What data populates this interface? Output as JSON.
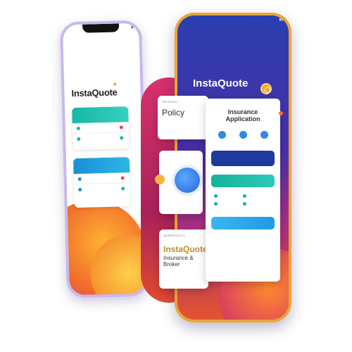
{
  "left_phone": {
    "status_time": "",
    "logo": "InstaQuote",
    "card_top": {
      "header": "",
      "rows": [
        "",
        ""
      ]
    },
    "card_bottom": {
      "header": "",
      "rows": [
        "",
        ""
      ]
    }
  },
  "right_phone": {
    "small_label": "",
    "title": "InstaQuote",
    "subtitle": ""
  },
  "policy_card": {
    "tag": "PROPOSAL",
    "title": "Policy",
    "desc": ""
  },
  "circle_card": {
    "center_label": "",
    "caption": ""
  },
  "insta_card": {
    "tag": "AGROPOLICY",
    "logo": "InstaQuote",
    "subtitle": "Insurance & Broker",
    "desc": ""
  },
  "application_card": {
    "tag": "",
    "title": "Insurance Application",
    "icons": [
      {
        "label": ""
      },
      {
        "label": ""
      },
      {
        "label": ""
      }
    ],
    "navy_button": "",
    "section_label": "",
    "teal_button": "",
    "grid": [
      "",
      "",
      "",
      ""
    ],
    "sky_button": ""
  },
  "colors": {
    "teal": "#18b7a6",
    "blue": "#1b8ed6",
    "navy": "#1e3a9e",
    "accent_orange": "#f6a826"
  }
}
